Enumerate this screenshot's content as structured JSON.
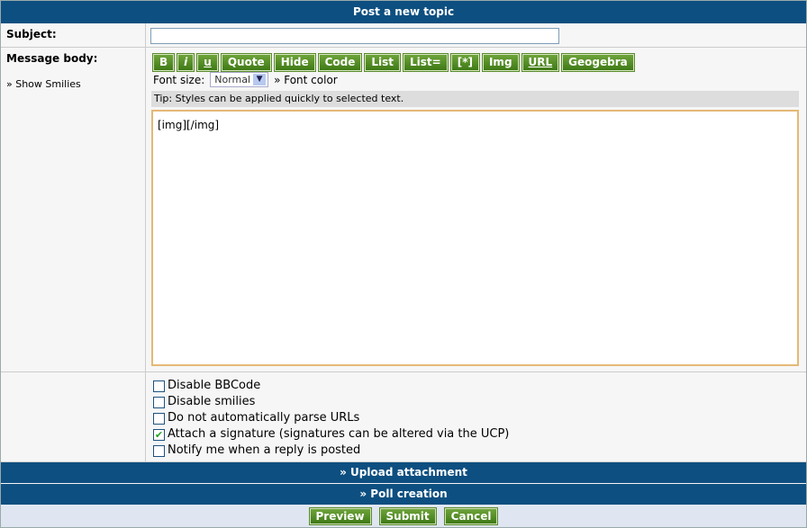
{
  "header": {
    "title": "Post a new topic"
  },
  "subject": {
    "label": "Subject:",
    "value": ""
  },
  "message": {
    "label": "Message body:",
    "show_smilies": "» Show Smilies",
    "toolbar": [
      "B",
      "i",
      "u",
      "Quote",
      "Hide",
      "Code",
      "List",
      "List=",
      "[*]",
      "Img",
      "URL",
      "Geogebra"
    ],
    "font_size_label": "Font size:",
    "font_size_value": "Normal",
    "font_color": "» Font color",
    "tip": "Tip: Styles can be applied quickly to selected text.",
    "body": "[img][/img]"
  },
  "options": [
    {
      "label": "Disable BBCode",
      "checked": false
    },
    {
      "label": "Disable smilies",
      "checked": false
    },
    {
      "label": "Do not automatically parse URLs",
      "checked": false
    },
    {
      "label": "Attach a signature (signatures can be altered via the UCP)",
      "checked": true
    },
    {
      "label": "Notify me when a reply is posted",
      "checked": false
    }
  ],
  "sections": {
    "upload": "» Upload attachment",
    "poll": "» Poll creation"
  },
  "buttons": {
    "preview": "Preview",
    "submit": "Submit",
    "cancel": "Cancel"
  }
}
